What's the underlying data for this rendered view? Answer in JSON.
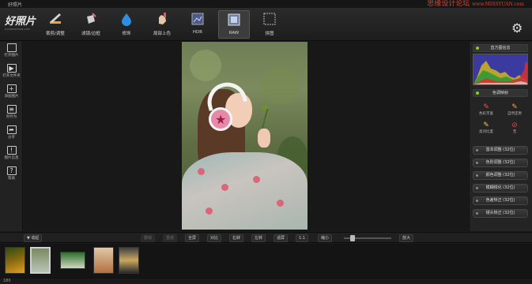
{
  "window": {
    "title": "好照片",
    "watermark": "思缘设计论坛",
    "watermark_url": "www.MISSYUAN.com"
  },
  "logo": {
    "main": "好照片",
    "sub": "HAOZHAOPIAN.COM"
  },
  "toolbar": {
    "tools": [
      {
        "label": "裁剪/调整"
      },
      {
        "label": "滤镜/边框"
      },
      {
        "label": "修饰"
      },
      {
        "label": "局部上色"
      },
      {
        "label": "HDR"
      },
      {
        "label": "RAW"
      },
      {
        "label": "拼图"
      }
    ]
  },
  "sidebar": {
    "items": [
      {
        "label": "打开图片"
      },
      {
        "label": "打开文件夹"
      },
      {
        "label": "添加图片"
      },
      {
        "label": "另存为"
      },
      {
        "label": "分享"
      },
      {
        "label": "图片信息"
      },
      {
        "label": "帮助"
      }
    ]
  },
  "right_panel": {
    "histogram_header": "直方图信息",
    "tone_header": "色调映射",
    "tone_options": [
      {
        "label": "色彩丰富"
      },
      {
        "label": "自然还原"
      },
      {
        "label": "高对比度"
      },
      {
        "label": "无"
      }
    ],
    "adjust_buttons": [
      {
        "label": "基本调整 (32位)"
      },
      {
        "label": "色阶调整 (32位)"
      },
      {
        "label": "颜色调整 (32位)"
      },
      {
        "label": "模糊锐化 (32位)"
      },
      {
        "label": "色差矫正 (32位)"
      },
      {
        "label": "镜头矫正 (32位)"
      }
    ]
  },
  "bottombar": {
    "collapse_label": "▼ 收起",
    "buttons": [
      {
        "label": "撤销",
        "disabled": true
      },
      {
        "label": "重做",
        "disabled": true
      },
      {
        "label": "全屏"
      },
      {
        "label": "对比"
      },
      {
        "label": "右转"
      },
      {
        "label": "左转"
      },
      {
        "label": "适屏"
      },
      {
        "label": "1:1"
      },
      {
        "label": "缩小"
      },
      {
        "label": "放大"
      }
    ]
  },
  "filmstrip": {
    "thumb_count": 5
  },
  "status": {
    "text": "180"
  },
  "colors": {
    "accent_green": "#7ed321",
    "background": "#1b1b1b",
    "watermark": "#c24a3b"
  }
}
